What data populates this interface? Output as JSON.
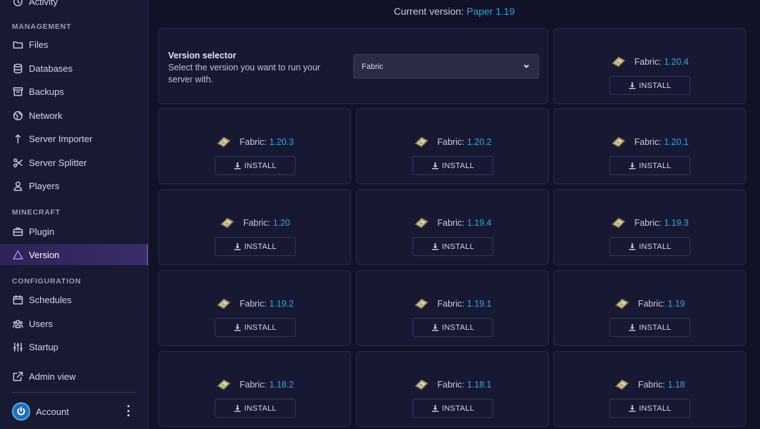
{
  "sidebar": {
    "top_item": "Activity",
    "sections": [
      {
        "label": "MANAGEMENT",
        "items": [
          "Files",
          "Databases",
          "Backups",
          "Network",
          "Server Importer",
          "Server Splitter",
          "Players"
        ]
      },
      {
        "label": "MINECRAFT",
        "items": [
          "Plugin",
          "Version"
        ]
      },
      {
        "label": "CONFIGURATION",
        "items": [
          "Schedules",
          "Users",
          "Startup"
        ]
      }
    ],
    "admin_view": "Admin view",
    "account": "Account",
    "active_item": "Version"
  },
  "header": {
    "current_label": "Current version:",
    "current_value": "Paper 1.19"
  },
  "selector": {
    "title": "Version selector",
    "description": "Select the version you want to run your server with.",
    "selected": "Fabric"
  },
  "versions": [
    {
      "name": "Fabric:",
      "version": "1.20.4",
      "button": "INSTALL"
    },
    {
      "name": "Fabric:",
      "version": "1.20.3",
      "button": "INSTALL"
    },
    {
      "name": "Fabric:",
      "version": "1.20.2",
      "button": "INSTALL"
    },
    {
      "name": "Fabric:",
      "version": "1.20.1",
      "button": "INSTALL"
    },
    {
      "name": "Fabric:",
      "version": "1.20",
      "button": "INSTALL"
    },
    {
      "name": "Fabric:",
      "version": "1.19.4",
      "button": "INSTALL"
    },
    {
      "name": "Fabric:",
      "version": "1.19.3",
      "button": "INSTALL"
    },
    {
      "name": "Fabric:",
      "version": "1.19.2",
      "button": "INSTALL"
    },
    {
      "name": "Fabric:",
      "version": "1.19.1",
      "button": "INSTALL"
    },
    {
      "name": "Fabric:",
      "version": "1.19",
      "button": "INSTALL"
    },
    {
      "name": "Fabric:",
      "version": "1.18.2",
      "button": "INSTALL"
    },
    {
      "name": "Fabric:",
      "version": "1.18.1",
      "button": "INSTALL"
    },
    {
      "name": "Fabric:",
      "version": "1.18",
      "button": "INSTALL"
    }
  ],
  "icons": {
    "version_card": "fabric-ticket-icon",
    "install": "download-icon"
  },
  "colors": {
    "accent": "#38a3d9",
    "active": "#8b5cf6",
    "background": "#111228"
  }
}
